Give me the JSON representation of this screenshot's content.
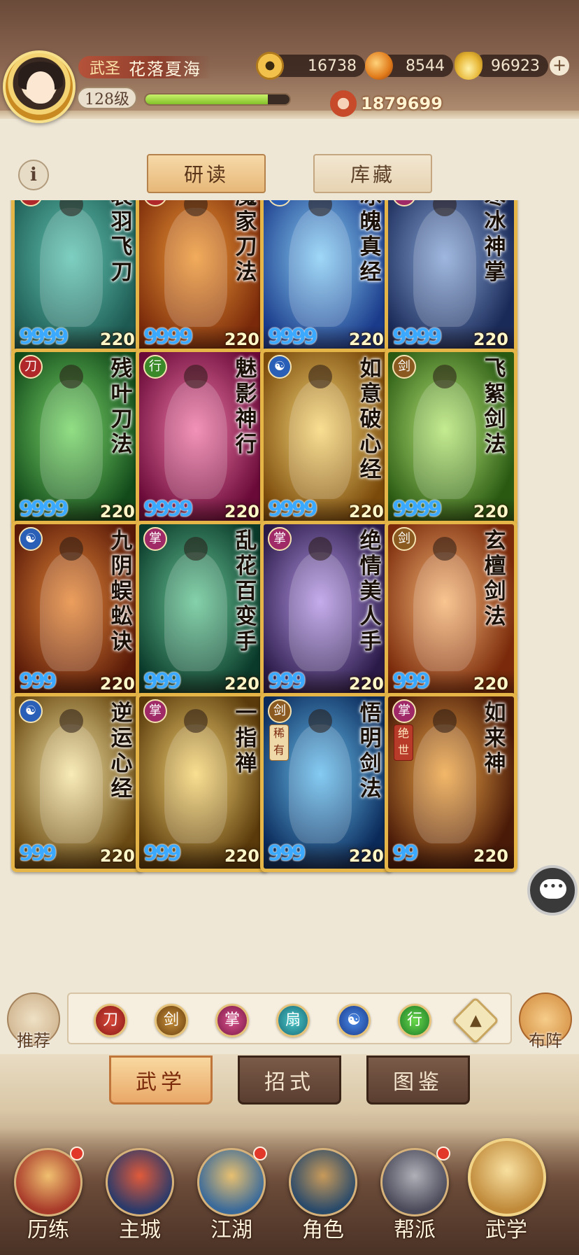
{
  "header": {
    "rank_title": "武圣",
    "player_name": "花落夏海",
    "level": "128级",
    "exp_fraction": 0.85,
    "currency": [
      {
        "icon": "coin-icon",
        "value": "16738"
      },
      {
        "icon": "fruit-icon",
        "value": "8544"
      },
      {
        "icon": "ingot-icon",
        "value": "96923"
      }
    ],
    "plus": "+",
    "combat_power": "1879699"
  },
  "info_button": "i",
  "sub_tabs": [
    "研读",
    "库藏"
  ],
  "cards": [
    {
      "name": "哀羽飞刀",
      "type_icon": "blade-icon",
      "glyph": "刀",
      "stars": "9999",
      "level": "220",
      "bg": [
        "#1d5a52",
        "#62c6b4"
      ]
    },
    {
      "name": "魔家刀法",
      "type_icon": "blade-icon",
      "glyph": "刀",
      "stars": "9999",
      "level": "220",
      "bg": [
        "#7a2a0a",
        "#f09a38"
      ]
    },
    {
      "name": "冰魄真经",
      "type_icon": "spirit-icon",
      "glyph": "☯",
      "stars": "9999",
      "level": "220",
      "bg": [
        "#1a3a8a",
        "#8ad0f6"
      ]
    },
    {
      "name": "寒冰神掌",
      "type_icon": "palm-icon",
      "glyph": "掌",
      "stars": "9999",
      "level": "220",
      "bg": [
        "#1a2a58",
        "#8aa8d8"
      ]
    },
    {
      "name": "残叶刀法",
      "type_icon": "blade-icon",
      "glyph": "刀",
      "stars": "9999",
      "level": "220",
      "bg": [
        "#124a1a",
        "#7ad86a"
      ]
    },
    {
      "name": "魅影神行",
      "type_icon": "leaf-icon",
      "glyph": "行",
      "stars": "9999",
      "level": "220",
      "bg": [
        "#6a0a38",
        "#f07aa8"
      ]
    },
    {
      "name": "如意破心经",
      "type_icon": "spirit-icon",
      "glyph": "☯",
      "stars": "9999",
      "level": "220",
      "bg": [
        "#7a4a0a",
        "#f8d87a"
      ]
    },
    {
      "name": "飞絮剑法",
      "type_icon": "sword-icon",
      "glyph": "剑",
      "stars": "9999",
      "level": "220",
      "bg": [
        "#2a5a12",
        "#b8e878"
      ]
    },
    {
      "name": "九阴蜈蚣诀",
      "type_icon": "spirit-icon",
      "glyph": "☯",
      "stars": "999",
      "level": "220",
      "bg": [
        "#5a1a08",
        "#e88a3a"
      ]
    },
    {
      "name": "乱花百变手",
      "type_icon": "palm-icon",
      "glyph": "掌",
      "stars": "999",
      "level": "220",
      "bg": [
        "#0a3a2a",
        "#6ac898"
      ]
    },
    {
      "name": "绝情美人手",
      "type_icon": "palm-icon",
      "glyph": "掌",
      "stars": "999",
      "level": "220",
      "bg": [
        "#2a1a48",
        "#b89ae8"
      ]
    },
    {
      "name": "玄檀剑法",
      "type_icon": "sword-icon",
      "glyph": "剑",
      "stars": "999",
      "level": "220",
      "bg": [
        "#7a2a0a",
        "#f8b878"
      ]
    },
    {
      "name": "逆运心经",
      "type_icon": "spirit-icon",
      "glyph": "☯",
      "stars": "999",
      "level": "220",
      "bg": [
        "#6a4a12",
        "#f8e8a8"
      ]
    },
    {
      "name": "一指禅",
      "type_icon": "palm-icon",
      "glyph": "掌",
      "stars": "999",
      "level": "220",
      "bg": [
        "#5a3a0a",
        "#f8d878"
      ]
    },
    {
      "name": "悟明剑法",
      "type_icon": "sword-icon",
      "glyph": "剑",
      "stars": "999",
      "level": "220",
      "bg": [
        "#0a2a5a",
        "#6ac0f0"
      ],
      "rarity": "稀有"
    },
    {
      "name": "如来神",
      "type_icon": "palm-icon",
      "glyph": "掌",
      "stars": "99",
      "level": "220",
      "bg": [
        "#4a1a08",
        "#f0a848"
      ],
      "rarity": "绝世"
    }
  ],
  "filters": [
    {
      "icon": "blade-filter-icon",
      "glyph": "刀"
    },
    {
      "icon": "sword-filter-icon",
      "glyph": "剑"
    },
    {
      "icon": "palm-filter-icon",
      "glyph": "掌"
    },
    {
      "icon": "fan-filter-icon",
      "glyph": "扇"
    },
    {
      "icon": "spirit-filter-icon",
      "glyph": "☯"
    },
    {
      "icon": "leaf-filter-icon",
      "glyph": "行"
    },
    {
      "icon": "collapse-up-icon",
      "glyph": "▲"
    }
  ],
  "side_buttons": {
    "left": "推荐",
    "right": "布阵"
  },
  "main_tabs": [
    "武学",
    "招式",
    "图鉴"
  ],
  "nav": [
    {
      "label": "历练",
      "badge": true,
      "colors": [
        "#a83a2a",
        "#f0c070"
      ]
    },
    {
      "label": "主城",
      "badge": false,
      "colors": [
        "#2a3a6a",
        "#e05a3a"
      ]
    },
    {
      "label": "江湖",
      "badge": true,
      "colors": [
        "#3a6a9a",
        "#e8c070"
      ]
    },
    {
      "label": "角色",
      "badge": false,
      "colors": [
        "#2a4a6a",
        "#c89a5a"
      ]
    },
    {
      "label": "帮派",
      "badge": true,
      "colors": [
        "#4a4a5a",
        "#b0b0b8"
      ]
    },
    {
      "label": "武学",
      "badge": false,
      "colors": [
        "#c08a3a",
        "#f8e0a0"
      ]
    }
  ],
  "colors": {
    "accent_gold": "#e6b548",
    "exp_green": "#84c02a",
    "badge_red": "#e2382a"
  }
}
